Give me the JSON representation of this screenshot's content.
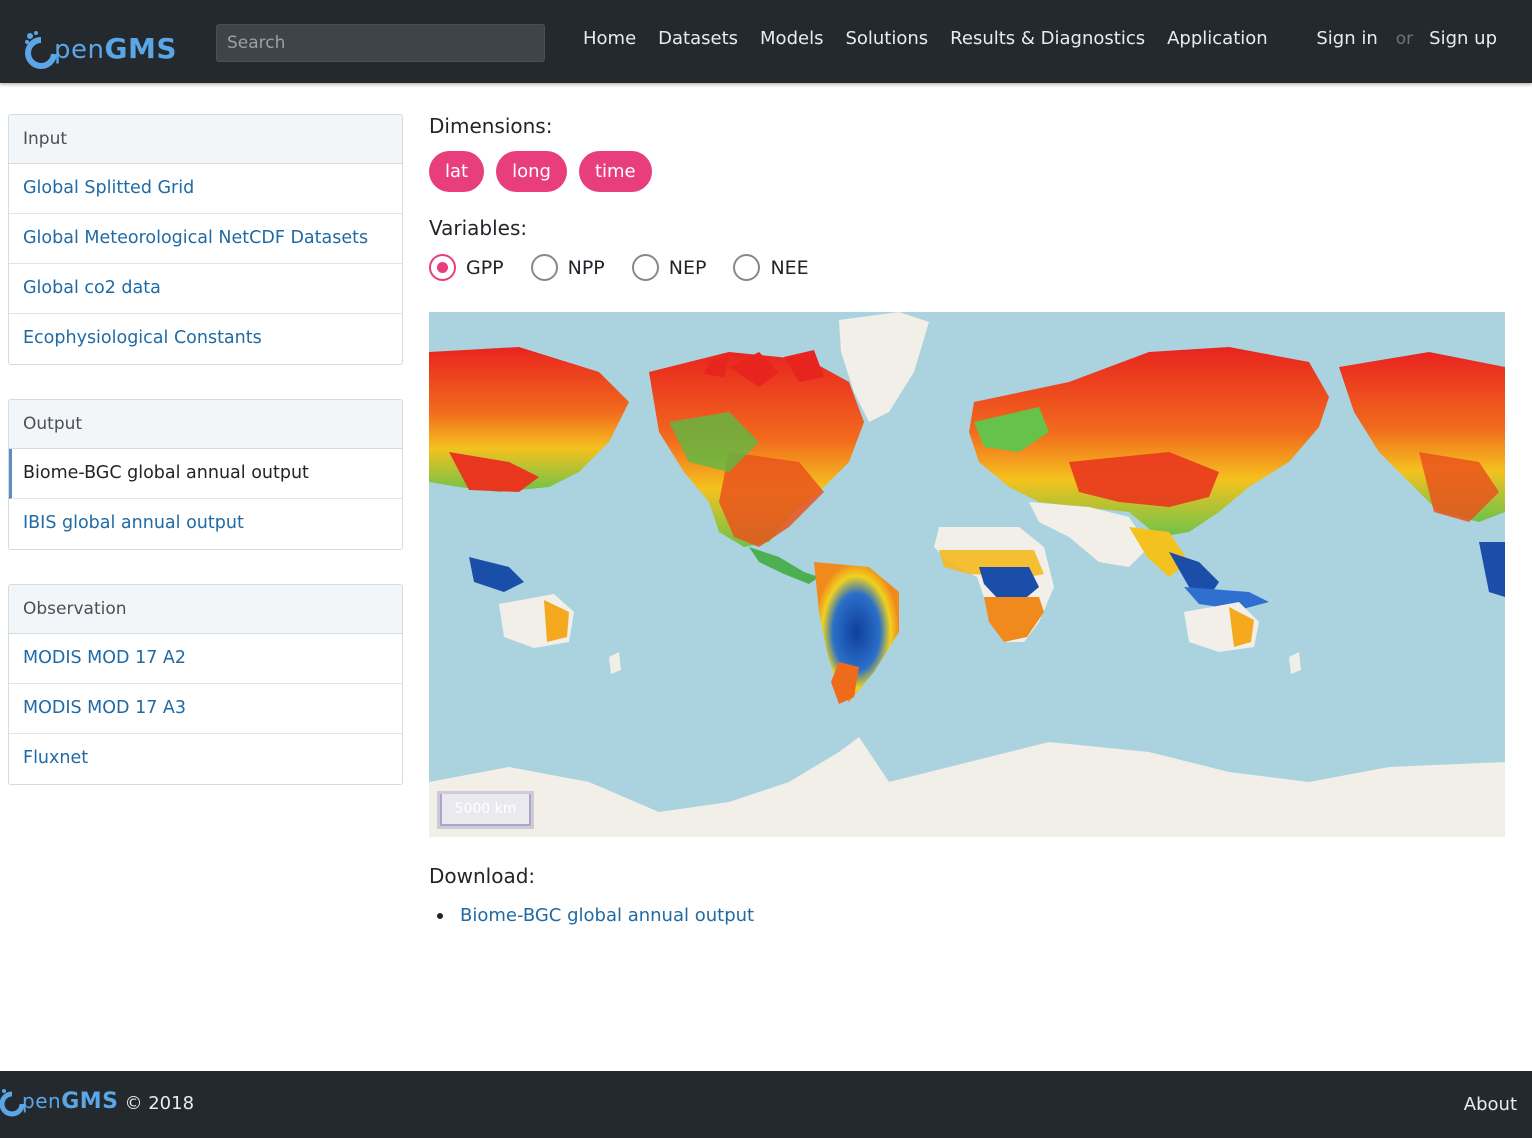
{
  "brand": {
    "logo_o": "O",
    "logo_pen": "pen",
    "logo_gms": "GMS"
  },
  "search": {
    "placeholder": "Search"
  },
  "nav": {
    "items": [
      "Home",
      "Datasets",
      "Models",
      "Solutions",
      "Results & Diagnostics",
      "Application"
    ]
  },
  "auth": {
    "sign_in": "Sign in",
    "or": "or",
    "sign_up": "Sign up"
  },
  "sidebar": {
    "groups": [
      {
        "title": "Input",
        "items": [
          "Global Splitted Grid",
          "Global Meteorological NetCDF Datasets",
          "Global co2 data",
          "Ecophysiological Constants"
        ]
      },
      {
        "title": "Output",
        "items": [
          "Biome-BGC global annual output",
          "IBIS global annual output"
        ],
        "active_index": 0
      },
      {
        "title": "Observation",
        "items": [
          "MODIS MOD 17 A2",
          "MODIS MOD 17 A3",
          "Fluxnet"
        ]
      }
    ]
  },
  "main": {
    "dimensions_label": "Dimensions:",
    "dimensions": [
      "lat",
      "long",
      "time"
    ],
    "variables_label": "Variables:",
    "variables": [
      "GPP",
      "NPP",
      "NEP",
      "NEE"
    ],
    "selected_variable": "GPP",
    "map": {
      "scale_label": "5000 km",
      "ocean_color": "#aad3df",
      "land_color": "#f2efe9"
    },
    "download_label": "Download:",
    "download_links": [
      "Biome-BGC global annual output"
    ]
  },
  "footer": {
    "copyright": "© 2018",
    "about": "About"
  },
  "colors": {
    "navbar": "#24292e",
    "accent": "#e83e7c",
    "link": "#1f6aa5"
  }
}
